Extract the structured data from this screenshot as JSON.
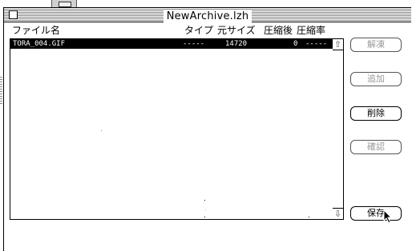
{
  "window": {
    "title": "NewArchive.lzh"
  },
  "columns": {
    "name": "ファイル名",
    "type": "タイプ",
    "original_size": "元サイズ",
    "compressed_size": "圧縮後",
    "ratio": "圧縮率"
  },
  "files": [
    {
      "name": "TORA_004.GIF",
      "type": "-----",
      "original_size": "14720",
      "compressed_size": "0",
      "ratio": "-----"
    }
  ],
  "buttons": {
    "extract": "解凍",
    "add": "追加",
    "delete": "削除",
    "confirm": "確認",
    "save": "保存"
  },
  "icons": {
    "scroll_up": "scroll-up-arrow",
    "scroll_down": "scroll-down-arrow",
    "pointer": "mouse-pointer"
  }
}
